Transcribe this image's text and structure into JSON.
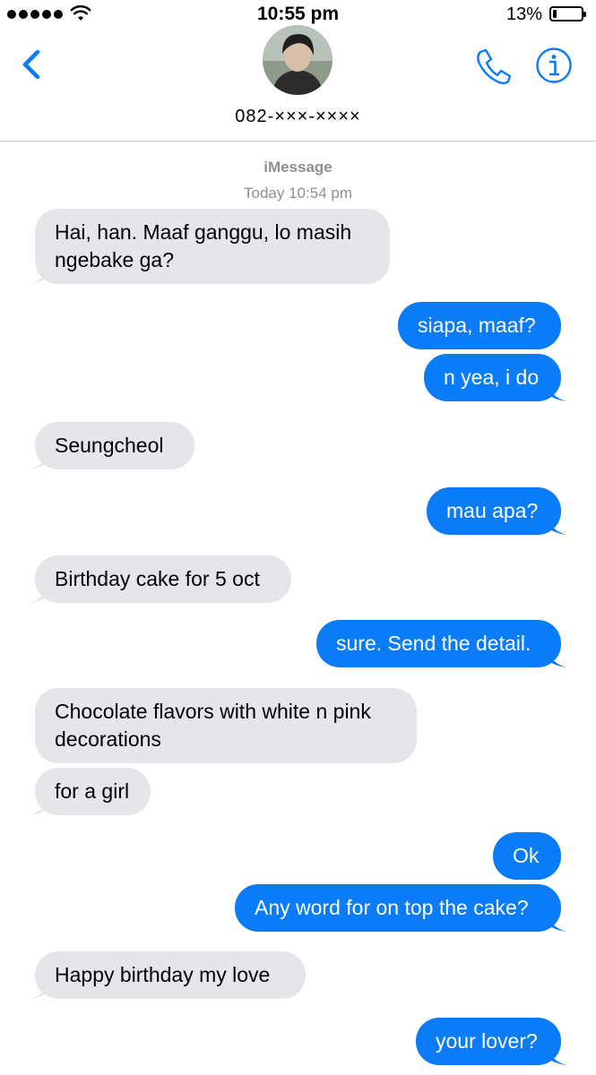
{
  "status_bar": {
    "time": "10:55 pm",
    "battery_percent": "13%",
    "battery_level": 0.13,
    "signal_bars": 5
  },
  "header": {
    "contact_name": "082-×××-××××",
    "back_icon": "chevron-left-icon",
    "phone_icon": "phone-icon",
    "info_icon": "info-icon"
  },
  "conversation": {
    "service": "iMessage",
    "timestamp": "Today 10:54 pm"
  },
  "messages": [
    {
      "from": "them",
      "text": "Hai, han. Maaf ganggu, lo masih ngebake ga?"
    },
    {
      "from": "me",
      "text": "siapa, maaf?"
    },
    {
      "from": "me",
      "text": "n yea, i do"
    },
    {
      "from": "them",
      "text": "Seungcheol"
    },
    {
      "from": "me",
      "text": "mau apa?"
    },
    {
      "from": "them",
      "text": "Birthday cake for 5 oct"
    },
    {
      "from": "me",
      "text": "sure. Send the detail."
    },
    {
      "from": "them",
      "text": "Chocolate flavors with white n pink decorations"
    },
    {
      "from": "them",
      "text": "for a girl"
    },
    {
      "from": "me",
      "text": "Ok"
    },
    {
      "from": "me",
      "text": "Any word for on top the cake?"
    },
    {
      "from": "them",
      "text": "Happy birthday my love"
    },
    {
      "from": "me",
      "text": "your lover?"
    }
  ],
  "colors": {
    "accent": "#0a7cf7",
    "incoming_bubble": "#e5e5ea",
    "meta_text": "#8e8e93"
  }
}
